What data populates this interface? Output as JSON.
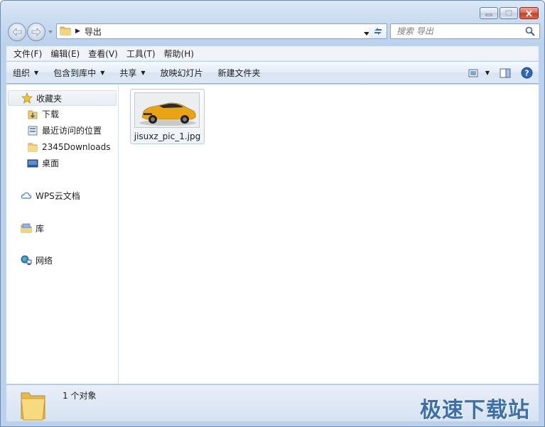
{
  "window": {
    "caption": {
      "minimize": "minimize",
      "maximize": "maximize",
      "close": "close"
    }
  },
  "address": {
    "path": "导出",
    "search_placeholder": "搜索 导出"
  },
  "menu": [
    "文件(F)",
    "编辑(E)",
    "查看(V)",
    "工具(T)",
    "帮助(H)"
  ],
  "toolbar": {
    "organize": "组织",
    "include_library": "包含到库中",
    "share": "共享",
    "slideshow": "放映幻灯片",
    "new_folder": "新建文件夹"
  },
  "sidebar": {
    "favorites": {
      "label": "收藏夹",
      "items": [
        "下载",
        "最近访问的位置",
        "2345Downloads",
        "桌面"
      ]
    },
    "wps": "WPS云文档",
    "library": "库",
    "network": "网络"
  },
  "files": [
    {
      "name": "jisuxz_pic_1.jpg"
    }
  ],
  "status": {
    "count_text": "1 个对象"
  },
  "watermark": "极速下载站",
  "colors": {
    "accent": "#3e6fa8",
    "close_button": "#c73a20",
    "car_body": "#e8a413"
  }
}
